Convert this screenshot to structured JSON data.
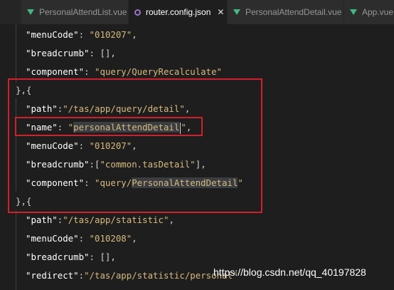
{
  "tabs": [
    {
      "label": "PersonalAttendList.vue",
      "icon": "vue-icon",
      "active": false
    },
    {
      "label": "router.config.json",
      "icon": "json-icon",
      "active": true,
      "close": "✕"
    },
    {
      "label": "PersonalAttendDetail.vue",
      "icon": "vue-icon",
      "active": false
    },
    {
      "label": "App.vue",
      "icon": "vue-icon",
      "active": false
    }
  ],
  "code": {
    "l1": {
      "key": "\"menuCode\"",
      "colon": ": ",
      "val": "\"010207\"",
      "end": ","
    },
    "l2": {
      "key": "\"breadcrumb\"",
      "rest": ": [],"
    },
    "l3": {
      "key": "\"component\"",
      "colon": ": ",
      "val": "\"query/QueryRecalculate\""
    },
    "l4": {
      "text": "},{"
    },
    "l5": {
      "key": "\"path\"",
      "colon": ":",
      "val": "\"/tas/app/query/detail\"",
      "end": ","
    },
    "l6": {
      "key": "\"name\"",
      "colon": ": ",
      "q1": "\"",
      "val": "personalAttendDetail",
      "q2": "\"",
      "end": ","
    },
    "l7": {
      "key": "\"menuCode\"",
      "colon": ": ",
      "val": "\"010207\"",
      "end": ","
    },
    "l8": {
      "key": "\"breadcrumb\"",
      "colon": ":[",
      "val": "\"common.tasDetail\"",
      "end": "],"
    },
    "l9": {
      "key": "\"component\"",
      "colon": ": ",
      "val1": "\"query/",
      "val2": "PersonalAttendDetail",
      "val3": "\""
    },
    "l10": {
      "text": "},{"
    },
    "l11": {
      "key": "\"path\"",
      "colon": ":",
      "val": "\"/tas/app/statistic\"",
      "end": ","
    },
    "l12": {
      "key": "\"menuCode\"",
      "colon": ": ",
      "val": "\"010208\"",
      "end": ","
    },
    "l13": {
      "key": "\"breadcrumb\"",
      "rest": ": [],"
    },
    "l14": {
      "key": "\"redirect\"",
      "colon": ":",
      "val": "\"/tas/app/statistic/personal\""
    }
  },
  "watermark": "https://blog.csdn.net/qq_40197828",
  "colors": {
    "accent_box": "#d21f2b",
    "key": "#ffffff",
    "string": "#d7ba7d",
    "vue": "#41b883",
    "json": "#a074c4"
  }
}
